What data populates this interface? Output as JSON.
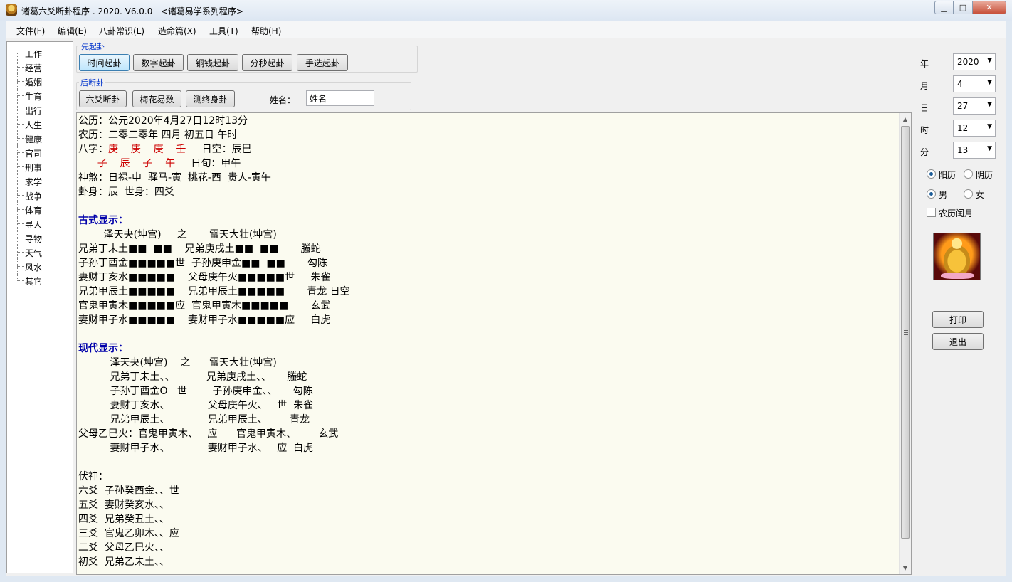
{
  "window": {
    "title": "诸葛六爻断卦程序 . 2020. V6.0.0   <诸葛易学系列程序>",
    "min": "▁",
    "max": "□",
    "close": "✕"
  },
  "menu": [
    "文件(F)",
    "编辑(E)",
    "八卦常识(L)",
    "造命篇(X)",
    "工具(T)",
    "帮助(H)"
  ],
  "tree": [
    "工作",
    "经营",
    "婚姻",
    "生育",
    "出行",
    "人生",
    "健康",
    "官司",
    "刑事",
    "求学",
    "战争",
    "体育",
    "寻人",
    "寻物",
    "天气",
    "风水",
    "其它"
  ],
  "groups": {
    "first": {
      "label": "先起卦",
      "buttons": [
        "时间起卦",
        "数字起卦",
        "铜钱起卦",
        "分秒起卦",
        "手选起卦"
      ]
    },
    "second": {
      "label": "后断卦",
      "buttons": [
        "六爻断卦",
        "梅花易数",
        "测终身卦"
      ],
      "name_label": "姓名：",
      "name_value": "姓名"
    }
  },
  "output": {
    "lines": [
      {
        "t": "公历：公元2020年4月27日12时13分"
      },
      {
        "t": "农历：二零二零年 四月 初五日 午时"
      },
      {
        "parts": [
          {
            "t": "八字："
          },
          {
            "t": "庚    庚    庚    壬",
            "c": "red"
          },
          {
            "t": "     日空：辰巳"
          }
        ]
      },
      {
        "parts": [
          {
            "t": "      "
          },
          {
            "t": "子    辰    子    午",
            "c": "red"
          },
          {
            "t": "     日旬：甲午"
          }
        ]
      },
      {
        "t": "神煞：日禄-申  驿马-寅  桃花-酉  贵人-寅午"
      },
      {
        "t": "卦身：辰  世身：四爻"
      },
      {
        "t": ""
      },
      {
        "t": "古式显示：",
        "c": "blue"
      },
      {
        "t": "        泽天夬(坤宫)     之       雷天大壮(坤宫)"
      },
      {
        "t": "兄弟丁未土■■  ■■    兄弟庚戌土■■  ■■       螣蛇"
      },
      {
        "t": "子孙丁酉金■■■■■世  子孙庚申金■■  ■■       勾陈"
      },
      {
        "t": "妻财丁亥水■■■■■    父母庚午火■■■■■世     朱雀"
      },
      {
        "t": "兄弟甲辰土■■■■■    兄弟甲辰土■■■■■       青龙 日空"
      },
      {
        "t": "官鬼甲寅木■■■■■应  官鬼甲寅木■■■■■       玄武"
      },
      {
        "t": "妻财甲子水■■■■■    妻财甲子水■■■■■应     白虎"
      },
      {
        "t": ""
      },
      {
        "t": "现代显示：",
        "c": "blue"
      },
      {
        "t": "          泽天夬(坤宫)    之      雷天大壮(坤宫)"
      },
      {
        "t": "          兄弟丁未土、、          兄弟庚戌土、、     螣蛇"
      },
      {
        "t": "          子孙丁酉金O   世        子孙庚申金、、     勾陈"
      },
      {
        "t": "          妻财丁亥水、            父母庚午火、   世  朱雀"
      },
      {
        "t": "          兄弟甲辰土、            兄弟甲辰土、       青龙"
      },
      {
        "t": "父母乙巳火：官鬼甲寅木、   应      官鬼甲寅木、       玄武"
      },
      {
        "t": "          妻财甲子水、            妻财甲子水、   应  白虎"
      },
      {
        "t": ""
      },
      {
        "t": "伏神："
      },
      {
        "t": "六爻  子孙癸酉金、、世"
      },
      {
        "t": "五爻  妻财癸亥水、、"
      },
      {
        "t": "四爻  兄弟癸丑土、、"
      },
      {
        "t": "三爻  官鬼乙卯木、、应"
      },
      {
        "t": "二爻  父母乙巳火、、"
      },
      {
        "t": "初爻  兄弟乙未土、、"
      }
    ]
  },
  "right_panel": {
    "fields": [
      {
        "label": "年",
        "value": "2020"
      },
      {
        "label": "月",
        "value": "4"
      },
      {
        "label": "日",
        "value": "27"
      },
      {
        "label": "时",
        "value": "12"
      },
      {
        "label": "分",
        "value": "13"
      }
    ],
    "calendar": [
      {
        "label": "阳历",
        "checked": true
      },
      {
        "label": "阴历",
        "checked": false
      }
    ],
    "gender": [
      {
        "label": "男",
        "checked": true
      },
      {
        "label": "女",
        "checked": false
      }
    ],
    "leap_month": {
      "label": "农历闰月",
      "checked": false
    },
    "print": "打印",
    "exit": "退出"
  },
  "colors": {
    "red": "#cc0000",
    "blue": "#0000aa",
    "accent": "#3c7fb1"
  }
}
